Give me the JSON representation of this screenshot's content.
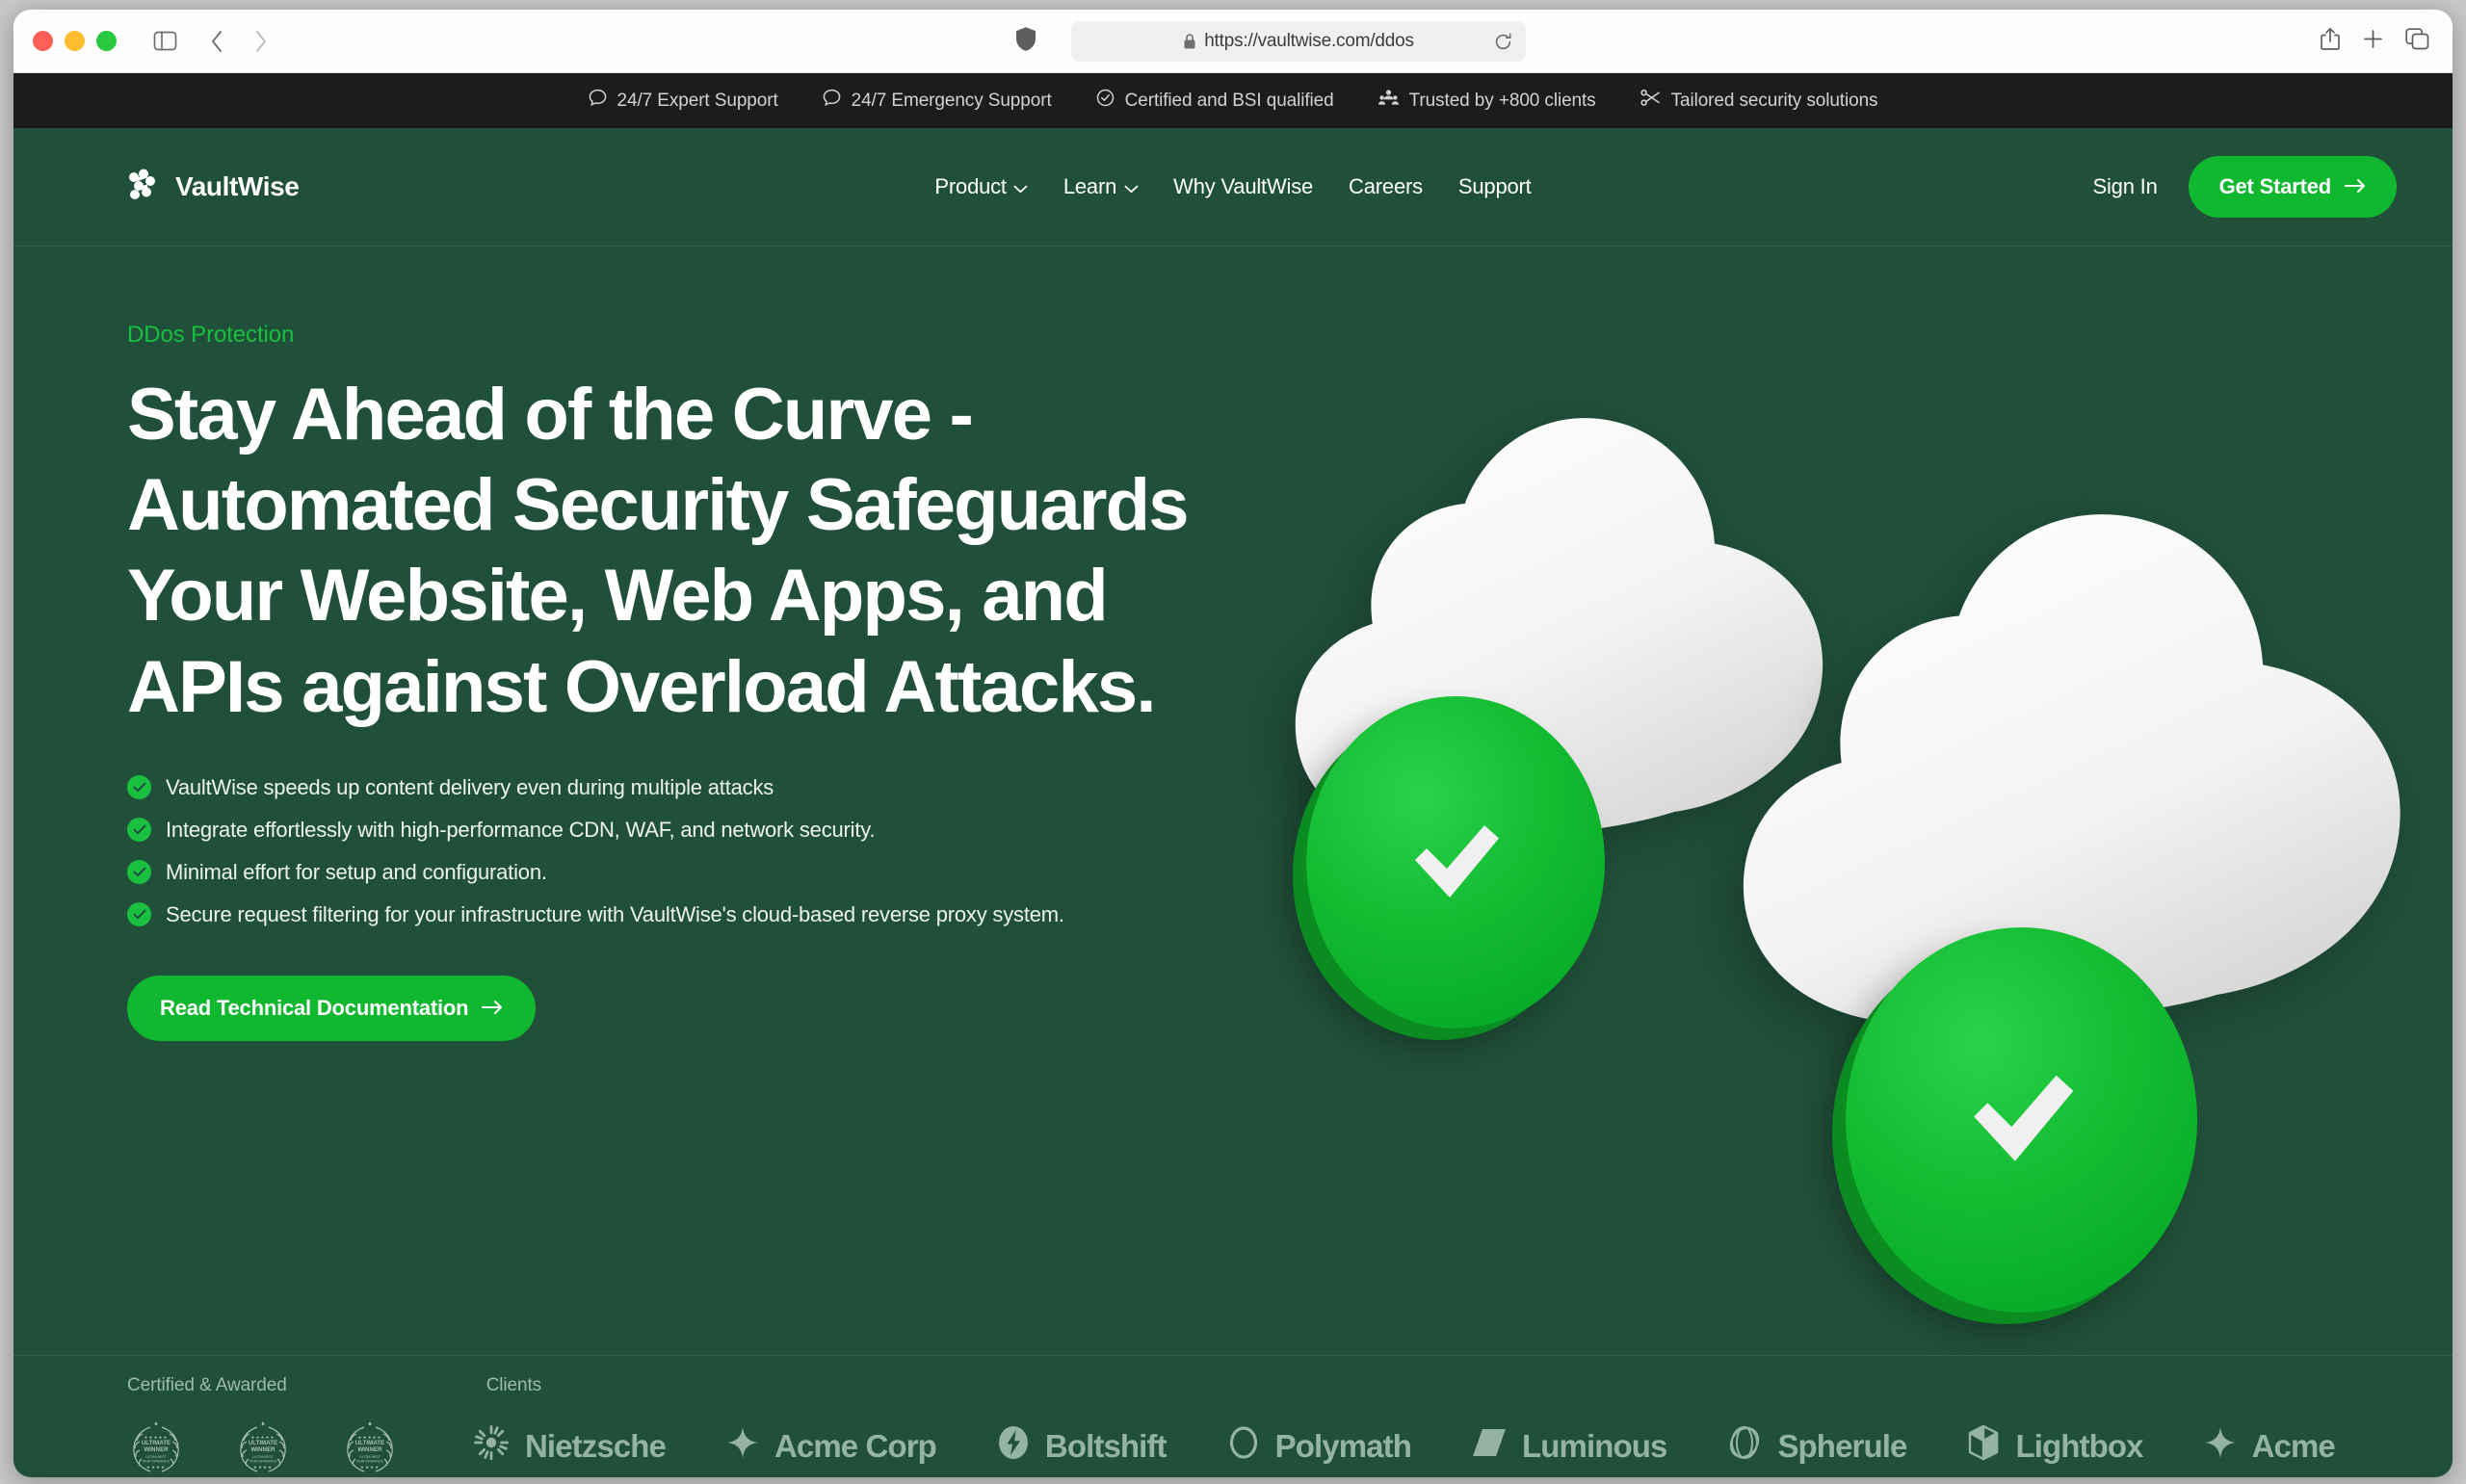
{
  "browser": {
    "url": "https://vaultwise.com/ddos",
    "lock_icon": "lock-icon",
    "shield_icon": "shield-icon",
    "reload_icon": "reload-icon",
    "sidebar_icon": "sidebar-toggle-icon",
    "back_icon": "back-arrow-icon",
    "forward_icon": "forward-arrow-icon",
    "share_icon": "share-icon",
    "newtab_icon": "plus-icon",
    "tabs_icon": "tab-overview-icon"
  },
  "announcement": {
    "items": [
      {
        "icon": "chat-bubble-icon",
        "label": "24/7 Expert Support"
      },
      {
        "icon": "chat-bubble-icon",
        "label": "24/7 Emergency Support"
      },
      {
        "icon": "check-circle-icon",
        "label": "Certified and BSI qualified"
      },
      {
        "icon": "people-group-icon",
        "label": "Trusted by +800 clients"
      },
      {
        "icon": "scissors-icon",
        "label": "Tailored security solutions"
      }
    ]
  },
  "header": {
    "brand": "VaultWise",
    "logo_icon": "vaultwise-node-logo",
    "nav": [
      {
        "label": "Product",
        "has_chevron": true
      },
      {
        "label": "Learn",
        "has_chevron": true
      },
      {
        "label": "Why VaultWise",
        "has_chevron": false
      },
      {
        "label": "Careers",
        "has_chevron": false
      },
      {
        "label": "Support",
        "has_chevron": false
      }
    ],
    "sign_in": "Sign In",
    "get_started": "Get Started"
  },
  "hero": {
    "eyebrow": "DDos Protection",
    "headline": "Stay Ahead of the Curve - Automated Security Safeguards Your Website, Web Apps, and APIs against Overload Attacks.",
    "bullets": [
      "VaultWise speeds up content delivery even during multiple attacks",
      "Integrate effortlessly with high-performance CDN, WAF, and network security.",
      "Minimal effort for setup and configuration.",
      "Secure request filtering for your infrastructure with VaultWise's cloud-based reverse proxy system."
    ],
    "cta": "Read Technical Documentation",
    "art": {
      "description": "two white 3D clouds with green circular check badges",
      "cloud_color": "#f2f2f2",
      "badge_color": "#10b830"
    }
  },
  "strip": {
    "awards_label": "Certified & Awarded",
    "clients_label": "Clients",
    "awards": [
      {
        "title": "ULTIMATE WINNER",
        "subtitle": "ULTRA BEST PERFORMANCE"
      },
      {
        "title": "ULTIMATE WINNER",
        "subtitle": "ULTRA BEST PERFORMANCE"
      },
      {
        "title": "ULTIMATE WINNER",
        "subtitle": "ULTRA BEST PERFORMANCE"
      }
    ],
    "clients": [
      {
        "name": "Nietzsche",
        "icon": "sunburst-icon"
      },
      {
        "name": "Acme Corp",
        "icon": "four-point-star-icon"
      },
      {
        "name": "Boltshift",
        "icon": "bolt-icon"
      },
      {
        "name": "Polymath",
        "icon": "ring-icon"
      },
      {
        "name": "Luminous",
        "icon": "slashes-icon"
      },
      {
        "name": "Spherule",
        "icon": "sphere-icon"
      },
      {
        "name": "Lightbox",
        "icon": "cube-icon"
      },
      {
        "name": "Acme",
        "icon": "four-point-star-icon"
      }
    ]
  },
  "colors": {
    "brand_green": "#20503a",
    "accent_green": "#10b830",
    "eyebrow_green": "#19bf3f",
    "announce_bg": "#1c1c1c"
  }
}
